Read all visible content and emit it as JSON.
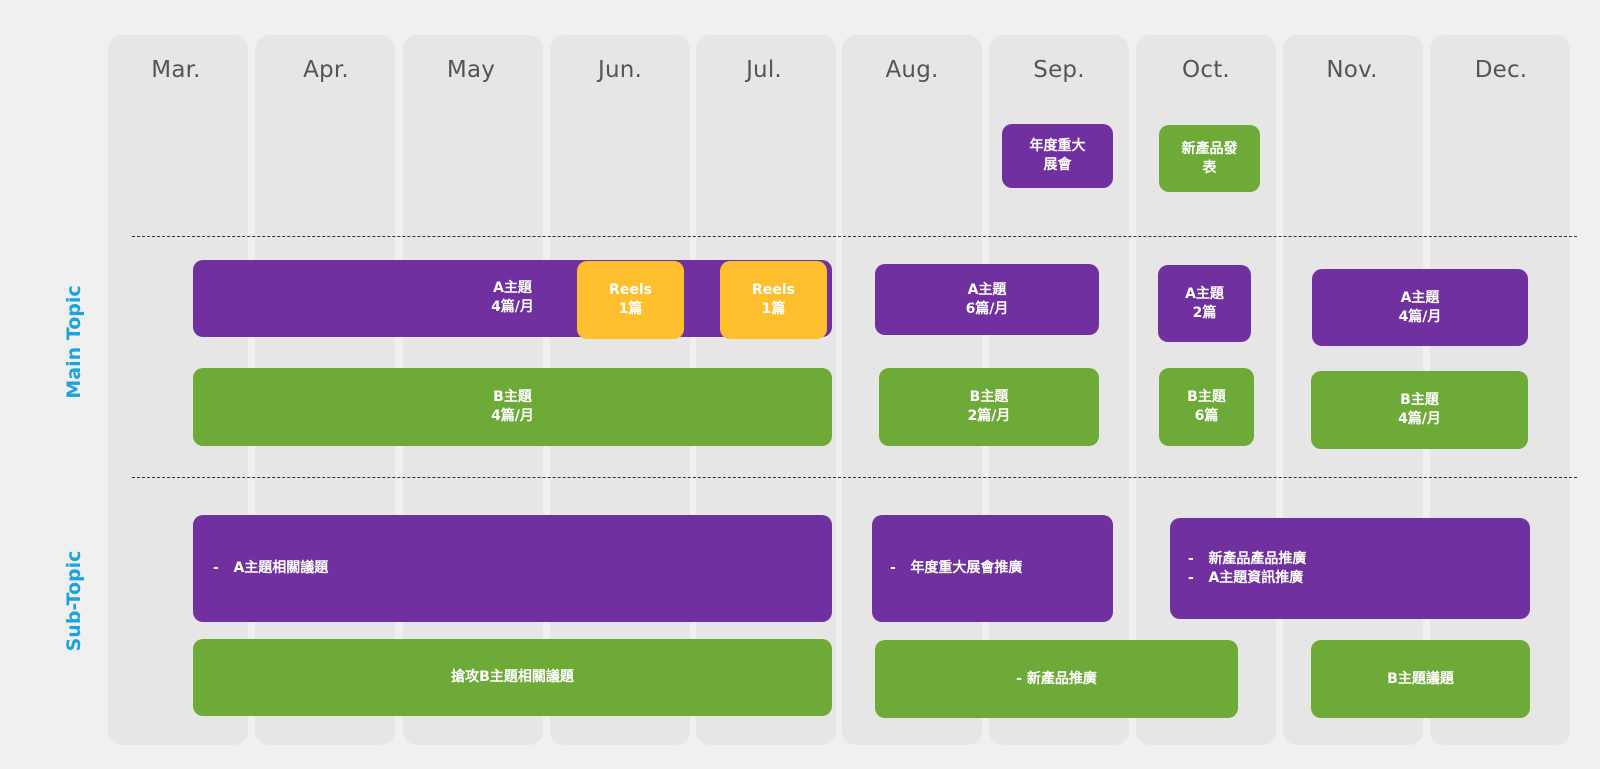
{
  "months": [
    "Mar.",
    "Apr.",
    "May",
    "Jun.",
    "Jul.",
    "Aug.",
    "Sep.",
    "Oct.",
    "Nov.",
    "Dec."
  ],
  "side_labels": {
    "main": "Main Topic",
    "sub": "Sub-Topic"
  },
  "events": {
    "sep": "年度重大\n展會",
    "oct": "新產品發\n表"
  },
  "main_topic": {
    "a_mar_jul": "A主題\n4篇/月",
    "reels_jun": "Reels\n1篇",
    "reels_jul": "Reels\n1篇",
    "a_aug_sep": "A主題\n6篇/月",
    "a_oct": "A主題\n2篇",
    "a_nov_dec": "A主題\n4篇/月",
    "b_mar_jul": "B主題\n4篇/月",
    "b_aug_sep": "B主題\n2篇/月",
    "b_oct": "B主題\n6篇",
    "b_nov_dec": "B主題\n4篇/月"
  },
  "sub_topic": {
    "a_mar_jul": [
      "A主題相關議題"
    ],
    "a_aug_sep": [
      "年度重大展會推廣"
    ],
    "a_oct_dec": [
      "新產品產品推廣",
      "A主題資訊推廣"
    ],
    "b_mar_jul": "搶攻B主題相關議題",
    "b_aug_oct": "- 新產品推廣",
    "b_nov_dec": "B主題議題"
  },
  "colors": {
    "purple": "#7030a0",
    "green": "#6eaa38",
    "yellow": "#fdbf2d",
    "label_blue": "#1ba3e0",
    "column_bg": "#e6e6e6"
  }
}
